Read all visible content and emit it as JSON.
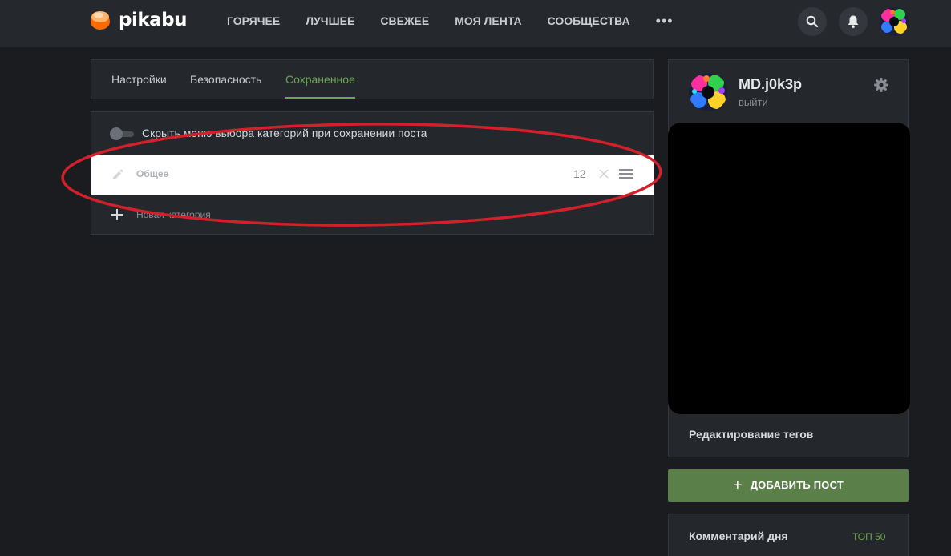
{
  "header": {
    "logo_text": "pikabu",
    "nav": [
      "ГОРЯЧЕЕ",
      "ЛУЧШЕЕ",
      "СВЕЖЕЕ",
      "МОЯ ЛЕНТА",
      "СООБЩЕСТВА"
    ],
    "more": "•••",
    "icons": [
      "search-icon",
      "bell-icon",
      "avatar"
    ]
  },
  "tabs": {
    "items": [
      "Настройки",
      "Безопасность",
      "Сохраненное"
    ],
    "active": "Сохраненное"
  },
  "saved": {
    "toggle_label": "Скрыть меню выбора категорий при сохранении поста",
    "toggle_on": false,
    "category": {
      "name": "Общее",
      "count": "12"
    },
    "new_category_label": "Новая категория"
  },
  "profile": {
    "username": "MD.j0k3p",
    "logout": "выйти",
    "tags_link": "Редактирование тегов"
  },
  "add_post": {
    "plus": "+",
    "label": "ДОБАВИТЬ ПОСТ"
  },
  "comment_of_day": {
    "title": "Комментарий дня",
    "link": "ТОП 50"
  },
  "colors": {
    "accent": "#6ea554",
    "add_post_bg": "#5a7f48",
    "annotation": "#d4202a",
    "background": "#1a1c20",
    "card": "#24272c"
  }
}
